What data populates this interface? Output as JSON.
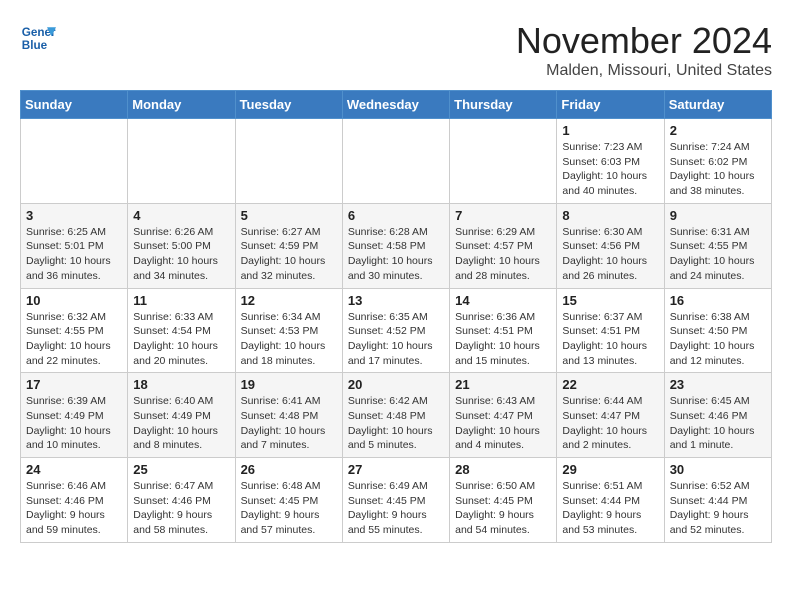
{
  "logo": {
    "line1": "General",
    "line2": "Blue"
  },
  "title": "November 2024",
  "location": "Malden, Missouri, United States",
  "weekdays": [
    "Sunday",
    "Monday",
    "Tuesday",
    "Wednesday",
    "Thursday",
    "Friday",
    "Saturday"
  ],
  "weeks": [
    [
      {
        "day": "",
        "info": ""
      },
      {
        "day": "",
        "info": ""
      },
      {
        "day": "",
        "info": ""
      },
      {
        "day": "",
        "info": ""
      },
      {
        "day": "",
        "info": ""
      },
      {
        "day": "1",
        "info": "Sunrise: 7:23 AM\nSunset: 6:03 PM\nDaylight: 10 hours and 40 minutes."
      },
      {
        "day": "2",
        "info": "Sunrise: 7:24 AM\nSunset: 6:02 PM\nDaylight: 10 hours and 38 minutes."
      }
    ],
    [
      {
        "day": "3",
        "info": "Sunrise: 6:25 AM\nSunset: 5:01 PM\nDaylight: 10 hours and 36 minutes."
      },
      {
        "day": "4",
        "info": "Sunrise: 6:26 AM\nSunset: 5:00 PM\nDaylight: 10 hours and 34 minutes."
      },
      {
        "day": "5",
        "info": "Sunrise: 6:27 AM\nSunset: 4:59 PM\nDaylight: 10 hours and 32 minutes."
      },
      {
        "day": "6",
        "info": "Sunrise: 6:28 AM\nSunset: 4:58 PM\nDaylight: 10 hours and 30 minutes."
      },
      {
        "day": "7",
        "info": "Sunrise: 6:29 AM\nSunset: 4:57 PM\nDaylight: 10 hours and 28 minutes."
      },
      {
        "day": "8",
        "info": "Sunrise: 6:30 AM\nSunset: 4:56 PM\nDaylight: 10 hours and 26 minutes."
      },
      {
        "day": "9",
        "info": "Sunrise: 6:31 AM\nSunset: 4:55 PM\nDaylight: 10 hours and 24 minutes."
      }
    ],
    [
      {
        "day": "10",
        "info": "Sunrise: 6:32 AM\nSunset: 4:55 PM\nDaylight: 10 hours and 22 minutes."
      },
      {
        "day": "11",
        "info": "Sunrise: 6:33 AM\nSunset: 4:54 PM\nDaylight: 10 hours and 20 minutes."
      },
      {
        "day": "12",
        "info": "Sunrise: 6:34 AM\nSunset: 4:53 PM\nDaylight: 10 hours and 18 minutes."
      },
      {
        "day": "13",
        "info": "Sunrise: 6:35 AM\nSunset: 4:52 PM\nDaylight: 10 hours and 17 minutes."
      },
      {
        "day": "14",
        "info": "Sunrise: 6:36 AM\nSunset: 4:51 PM\nDaylight: 10 hours and 15 minutes."
      },
      {
        "day": "15",
        "info": "Sunrise: 6:37 AM\nSunset: 4:51 PM\nDaylight: 10 hours and 13 minutes."
      },
      {
        "day": "16",
        "info": "Sunrise: 6:38 AM\nSunset: 4:50 PM\nDaylight: 10 hours and 12 minutes."
      }
    ],
    [
      {
        "day": "17",
        "info": "Sunrise: 6:39 AM\nSunset: 4:49 PM\nDaylight: 10 hours and 10 minutes."
      },
      {
        "day": "18",
        "info": "Sunrise: 6:40 AM\nSunset: 4:49 PM\nDaylight: 10 hours and 8 minutes."
      },
      {
        "day": "19",
        "info": "Sunrise: 6:41 AM\nSunset: 4:48 PM\nDaylight: 10 hours and 7 minutes."
      },
      {
        "day": "20",
        "info": "Sunrise: 6:42 AM\nSunset: 4:48 PM\nDaylight: 10 hours and 5 minutes."
      },
      {
        "day": "21",
        "info": "Sunrise: 6:43 AM\nSunset: 4:47 PM\nDaylight: 10 hours and 4 minutes."
      },
      {
        "day": "22",
        "info": "Sunrise: 6:44 AM\nSunset: 4:47 PM\nDaylight: 10 hours and 2 minutes."
      },
      {
        "day": "23",
        "info": "Sunrise: 6:45 AM\nSunset: 4:46 PM\nDaylight: 10 hours and 1 minute."
      }
    ],
    [
      {
        "day": "24",
        "info": "Sunrise: 6:46 AM\nSunset: 4:46 PM\nDaylight: 9 hours and 59 minutes."
      },
      {
        "day": "25",
        "info": "Sunrise: 6:47 AM\nSunset: 4:46 PM\nDaylight: 9 hours and 58 minutes."
      },
      {
        "day": "26",
        "info": "Sunrise: 6:48 AM\nSunset: 4:45 PM\nDaylight: 9 hours and 57 minutes."
      },
      {
        "day": "27",
        "info": "Sunrise: 6:49 AM\nSunset: 4:45 PM\nDaylight: 9 hours and 55 minutes."
      },
      {
        "day": "28",
        "info": "Sunrise: 6:50 AM\nSunset: 4:45 PM\nDaylight: 9 hours and 54 minutes."
      },
      {
        "day": "29",
        "info": "Sunrise: 6:51 AM\nSunset: 4:44 PM\nDaylight: 9 hours and 53 minutes."
      },
      {
        "day": "30",
        "info": "Sunrise: 6:52 AM\nSunset: 4:44 PM\nDaylight: 9 hours and 52 minutes."
      }
    ]
  ]
}
